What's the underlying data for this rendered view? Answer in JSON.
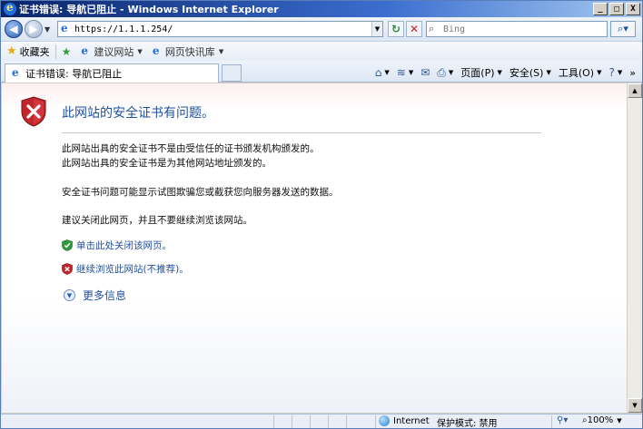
{
  "window": {
    "title": "证书错误: 导航已阻止 - Windows Internet Explorer",
    "min_glyph": "_",
    "max_glyph": "□",
    "close_glyph": "X"
  },
  "address": {
    "url": "https://1.1.1.254/",
    "search_placeholder": "Bing"
  },
  "favorites": {
    "label": "收藏夹",
    "items": [
      "建议网站",
      "网页快讯库"
    ]
  },
  "tab": {
    "title": "证书错误: 导航已阻止"
  },
  "commands": {
    "page": "页面(P)",
    "safety": "安全(S)",
    "tools": "工具(O)"
  },
  "error": {
    "title": "此网站的安全证书有问题。",
    "line1": "此网站出具的安全证书不是由受信任的证书颁发机构颁发的。",
    "line2": "此网站出具的安全证书是为其他网站地址颁发的。",
    "line3": "安全证书问题可能显示试图欺骗您或截获您向服务器发送的数据。",
    "line4": "建议关闭此网页，并且不要继续浏览该网站。",
    "close_link": "单击此处关闭该网页。",
    "continue_link": "继续浏览此网站(不推荐)。",
    "more_info": "更多信息"
  },
  "status": {
    "zone": "Internet",
    "protected_mode": "保护模式: 禁用",
    "zoom": "100%"
  },
  "colors": {
    "title_blue": "#1f4f9f",
    "shield_red": "#c0262c"
  }
}
